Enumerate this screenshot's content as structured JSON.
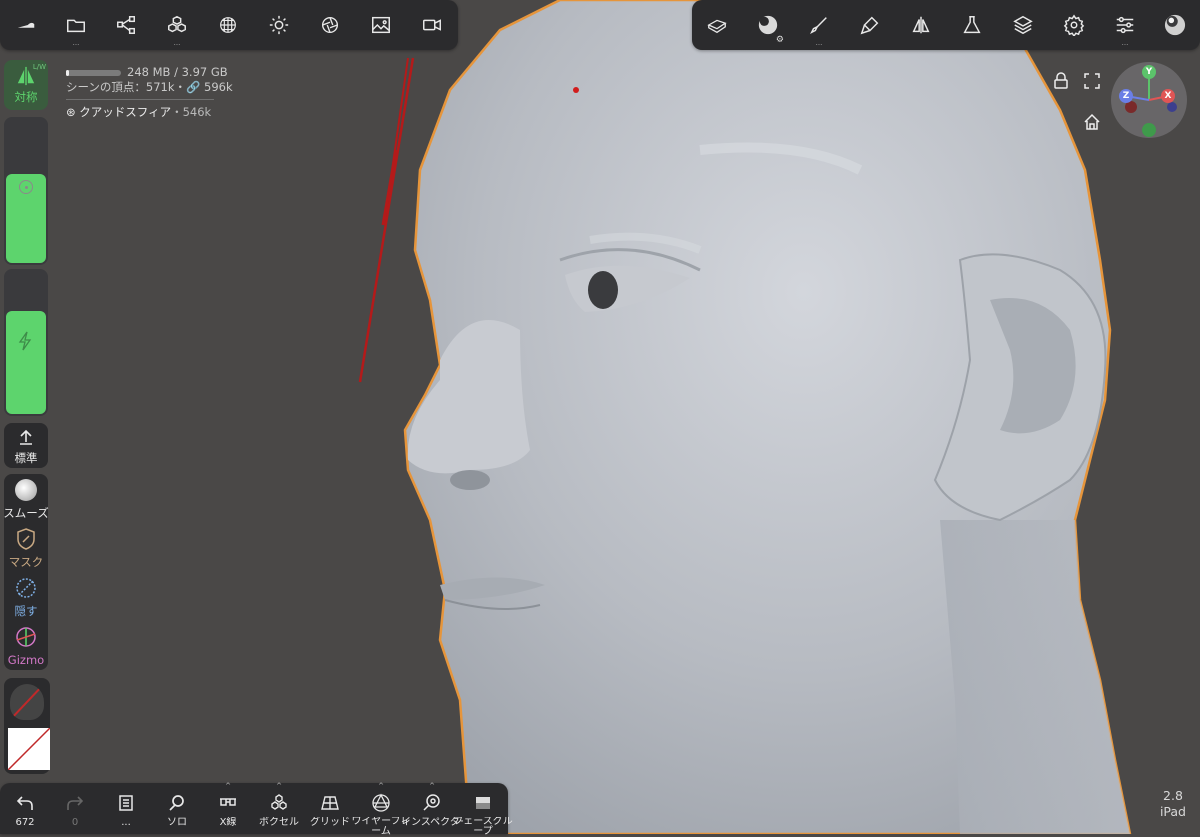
{
  "colors": {
    "accent": "#5dd46d",
    "selection_outline": "#e6953b",
    "panel": "#2b2b2d",
    "viewport_bg": "#4a4847",
    "mesh": "#b8bcc3",
    "axis_x": "#e05555",
    "axis_y": "#5cc36b",
    "axis_z": "#6b7fe6"
  },
  "top_left_toolbar": [
    {
      "icon": "shoe-icon"
    },
    {
      "icon": "folder-icon",
      "dots": "..."
    },
    {
      "icon": "share-nodes-icon"
    },
    {
      "icon": "cubes-icon",
      "dots": "..."
    },
    {
      "icon": "sphere-grid-icon"
    },
    {
      "icon": "sun-icon"
    },
    {
      "icon": "aperture-icon"
    },
    {
      "icon": "image-icon"
    },
    {
      "icon": "video-icon"
    }
  ],
  "top_right_toolbar": [
    {
      "icon": "mesh-box-icon"
    },
    {
      "icon": "material-sphere-icon",
      "badge": "gear"
    },
    {
      "icon": "brush-icon",
      "dots": "..."
    },
    {
      "icon": "paint-tube-icon"
    },
    {
      "icon": "symmetry-icon"
    },
    {
      "icon": "flask-icon"
    },
    {
      "icon": "layers-icon"
    },
    {
      "icon": "gear-icon"
    },
    {
      "icon": "sliders-icon",
      "dots": "..."
    },
    {
      "icon": "matcap-sphere-icon"
    }
  ],
  "info": {
    "memory": "248 MB / 3.97 GB",
    "scene_vertices": "シーンの頂点：571k・",
    "link_count": "596k",
    "object_name": "クアッドスフィア",
    "object_count": "・546k"
  },
  "left_panel": {
    "symmetry_label": "対称",
    "symmetry_corner": "L/W",
    "radius_value": 0.62,
    "intensity_value": 0.72,
    "standard_label": "標準",
    "smooth_label": "スムーズ",
    "mask_label": "マスク",
    "hide_label": "隠す",
    "gizmo_label": "Gizmo"
  },
  "bottom_toolbar": [
    {
      "label": "672",
      "icon": "undo-icon"
    },
    {
      "label": "0",
      "icon": "redo-icon"
    },
    {
      "label": "...",
      "icon": "book-icon"
    },
    {
      "label": "ソロ",
      "icon": "search-icon"
    },
    {
      "label": "X線",
      "icon": "glasses-icon",
      "caret": "^"
    },
    {
      "label": "ボクセル",
      "icon": "cubes-icon",
      "caret": "^"
    },
    {
      "label": "グリッド",
      "icon": "grid-plane-icon"
    },
    {
      "label": "ワイヤーフレーム",
      "icon": "wireframe-icon",
      "caret": "^"
    },
    {
      "label": "インスペクター",
      "icon": "inspector-icon",
      "caret": "^"
    },
    {
      "label": "フェースグループ",
      "icon": "facegroup-icon"
    }
  ],
  "version": "2.8",
  "device": "iPad",
  "gizmo_axes": {
    "y": "Y",
    "x": "X",
    "z": "Z"
  }
}
